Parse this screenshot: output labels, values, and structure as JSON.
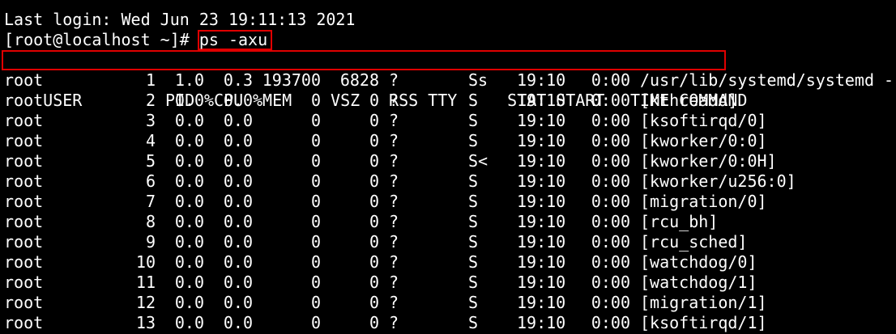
{
  "terminal": {
    "last_login": "Last login: Wed Jun 23 19:11:13 2021",
    "prompt": "[root@localhost ~]# ",
    "command": "ps -axu",
    "highlight_color": "#e00000"
  },
  "table": {
    "headers": {
      "user": "USER",
      "pid": "PID",
      "cpu": "%CPU",
      "mem": "%MEM",
      "vsz": "VSZ",
      "rss": "RSS",
      "tty": "TTY",
      "stat": "STAT",
      "start": "START",
      "time": "TIME",
      "command": "COMMAND"
    },
    "rows": [
      {
        "user": "root",
        "pid": "1",
        "cpu": "1.0",
        "mem": "0.3",
        "vsz": "193700",
        "rss": "6828",
        "tty": "?",
        "stat": "Ss",
        "start": "19:10",
        "time": "0:00",
        "command": "/usr/lib/systemd/systemd -"
      },
      {
        "user": "root",
        "pid": "2",
        "cpu": "0.0",
        "mem": "0.0",
        "vsz": "0",
        "rss": "0",
        "tty": "?",
        "stat": "S",
        "start": "19:10",
        "time": "0:00",
        "command": "[kthreadd]"
      },
      {
        "user": "root",
        "pid": "3",
        "cpu": "0.0",
        "mem": "0.0",
        "vsz": "0",
        "rss": "0",
        "tty": "?",
        "stat": "S",
        "start": "19:10",
        "time": "0:00",
        "command": "[ksoftirqd/0]"
      },
      {
        "user": "root",
        "pid": "4",
        "cpu": "0.0",
        "mem": "0.0",
        "vsz": "0",
        "rss": "0",
        "tty": "?",
        "stat": "S",
        "start": "19:10",
        "time": "0:00",
        "command": "[kworker/0:0]"
      },
      {
        "user": "root",
        "pid": "5",
        "cpu": "0.0",
        "mem": "0.0",
        "vsz": "0",
        "rss": "0",
        "tty": "?",
        "stat": "S<",
        "start": "19:10",
        "time": "0:00",
        "command": "[kworker/0:0H]"
      },
      {
        "user": "root",
        "pid": "6",
        "cpu": "0.0",
        "mem": "0.0",
        "vsz": "0",
        "rss": "0",
        "tty": "?",
        "stat": "S",
        "start": "19:10",
        "time": "0:00",
        "command": "[kworker/u256:0]"
      },
      {
        "user": "root",
        "pid": "7",
        "cpu": "0.0",
        "mem": "0.0",
        "vsz": "0",
        "rss": "0",
        "tty": "?",
        "stat": "S",
        "start": "19:10",
        "time": "0:00",
        "command": "[migration/0]"
      },
      {
        "user": "root",
        "pid": "8",
        "cpu": "0.0",
        "mem": "0.0",
        "vsz": "0",
        "rss": "0",
        "tty": "?",
        "stat": "S",
        "start": "19:10",
        "time": "0:00",
        "command": "[rcu_bh]"
      },
      {
        "user": "root",
        "pid": "9",
        "cpu": "0.0",
        "mem": "0.0",
        "vsz": "0",
        "rss": "0",
        "tty": "?",
        "stat": "S",
        "start": "19:10",
        "time": "0:00",
        "command": "[rcu_sched]"
      },
      {
        "user": "root",
        "pid": "10",
        "cpu": "0.0",
        "mem": "0.0",
        "vsz": "0",
        "rss": "0",
        "tty": "?",
        "stat": "S",
        "start": "19:10",
        "time": "0:00",
        "command": "[watchdog/0]"
      },
      {
        "user": "root",
        "pid": "11",
        "cpu": "0.0",
        "mem": "0.0",
        "vsz": "0",
        "rss": "0",
        "tty": "?",
        "stat": "S",
        "start": "19:10",
        "time": "0:00",
        "command": "[watchdog/1]"
      },
      {
        "user": "root",
        "pid": "12",
        "cpu": "0.0",
        "mem": "0.0",
        "vsz": "0",
        "rss": "0",
        "tty": "?",
        "stat": "S",
        "start": "19:10",
        "time": "0:00",
        "command": "[migration/1]"
      },
      {
        "user": "root",
        "pid": "13",
        "cpu": "0.0",
        "mem": "0.0",
        "vsz": "0",
        "rss": "0",
        "tty": "?",
        "stat": "S",
        "start": "19:10",
        "time": "0:00",
        "command": "[ksoftirqd/1]"
      }
    ]
  }
}
